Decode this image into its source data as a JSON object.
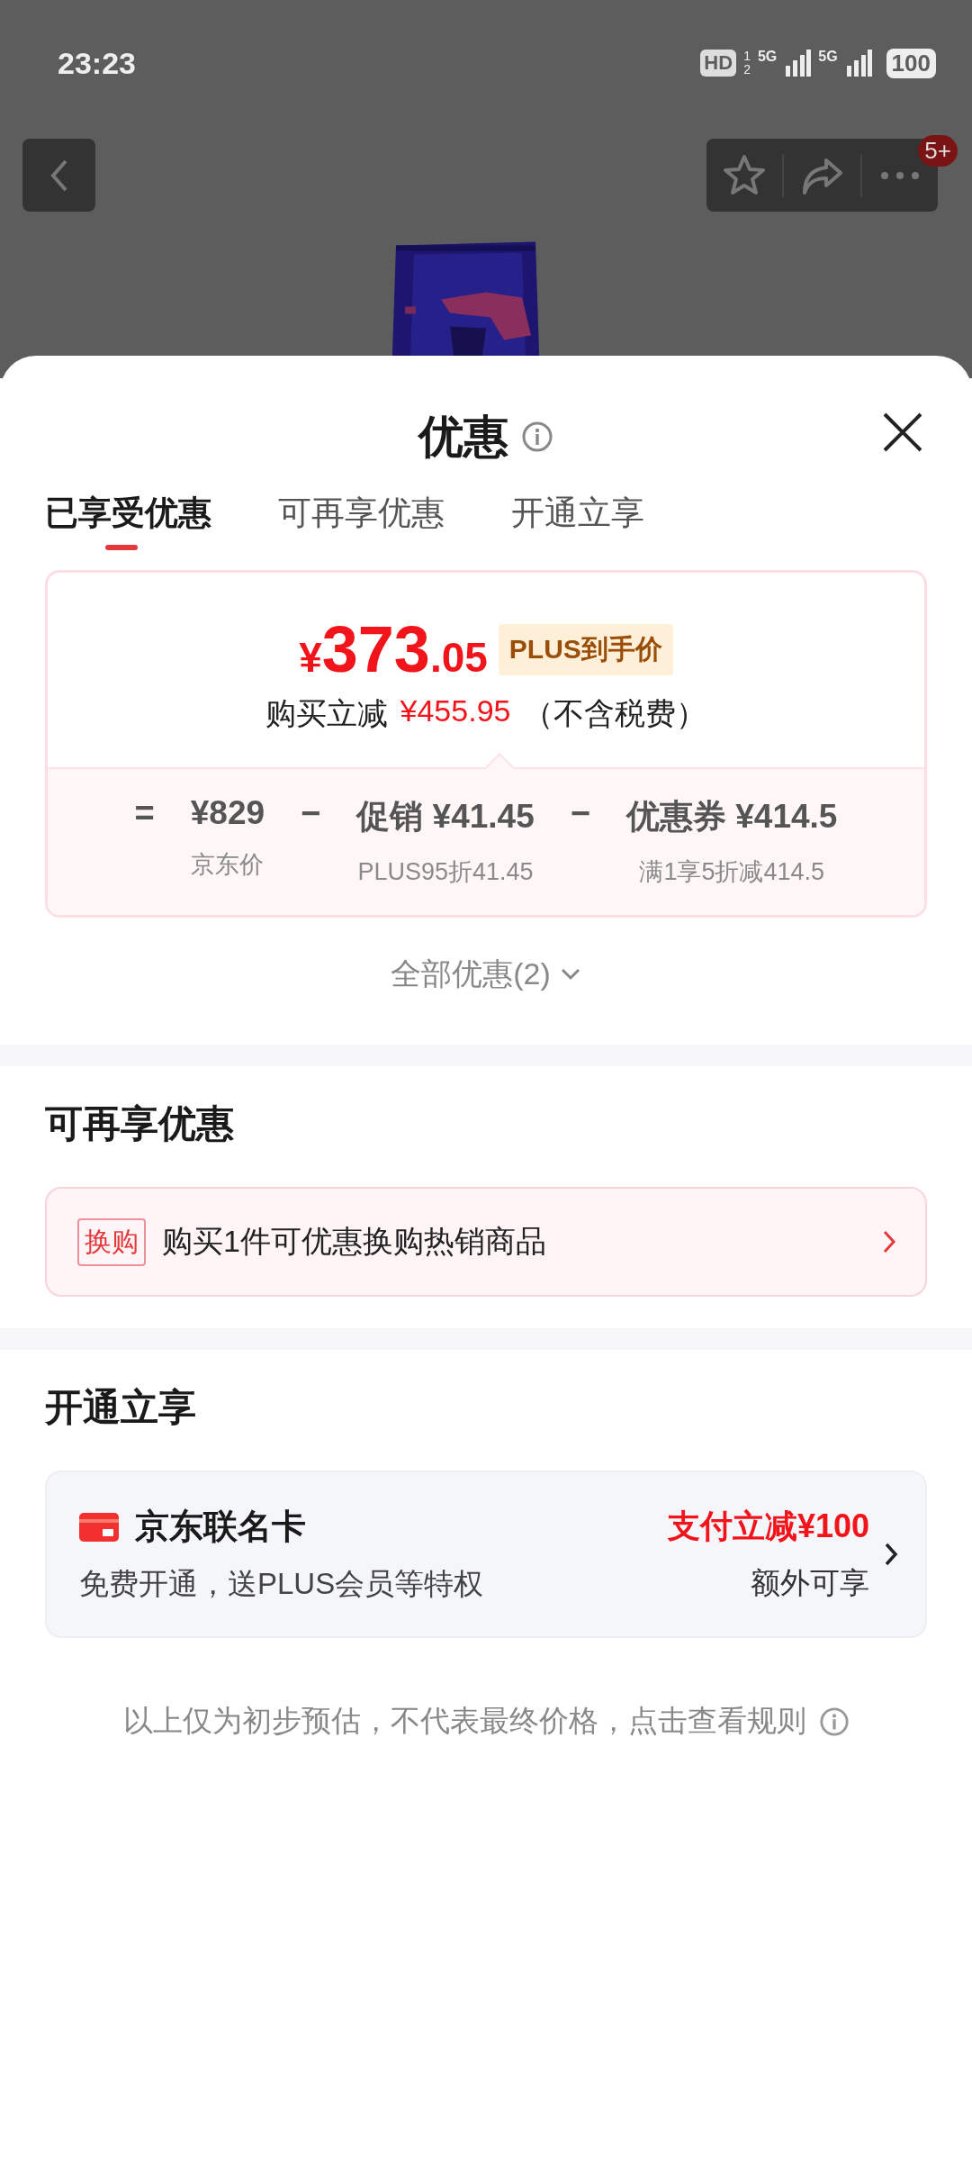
{
  "status_bar": {
    "time": "23:23",
    "hd": "HD",
    "sim_1": "1",
    "sim_2": "2",
    "network_1": "5G",
    "network_2": "5G",
    "battery": "100"
  },
  "top_bar": {
    "badge": "5+"
  },
  "sheet": {
    "title": "优惠",
    "tabs": [
      {
        "label": "已享受优惠",
        "selected": true
      },
      {
        "label": "可再享优惠",
        "selected": false
      },
      {
        "label": "开通立享",
        "selected": false
      }
    ],
    "price_card": {
      "currency": "¥",
      "price_main": "373",
      "price_decimal": ".05",
      "price_tag": "PLUS到手价",
      "saving_label": "购买立减",
      "saving_amount": "¥455.95",
      "saving_note": "（不含税费）",
      "breakdown": [
        {
          "kind": "operator",
          "symbol": "="
        },
        {
          "kind": "item",
          "value": "¥829",
          "caption": "京东价"
        },
        {
          "kind": "operator",
          "symbol": "−"
        },
        {
          "kind": "item",
          "value": "促销 ¥41.45",
          "caption": "PLUS95折41.45"
        },
        {
          "kind": "operator",
          "symbol": "−"
        },
        {
          "kind": "item",
          "value": "优惠券 ¥414.5",
          "caption": "满1享5折减414.5"
        }
      ]
    },
    "all_offers": "全部优惠(2)",
    "more_section": {
      "heading": "可再享优惠",
      "tag": "换购",
      "text": "购买1件可优惠换购热销商品"
    },
    "open_section": {
      "heading": "开通立享",
      "card_name": "京东联名卡",
      "card_desc": "免费开通，送PLUS会员等特权",
      "offer": "支付立减¥100",
      "offer_note": "额外可享"
    },
    "footer": "以上仅为初步预估，不代表最终价格，点击查看规则"
  }
}
